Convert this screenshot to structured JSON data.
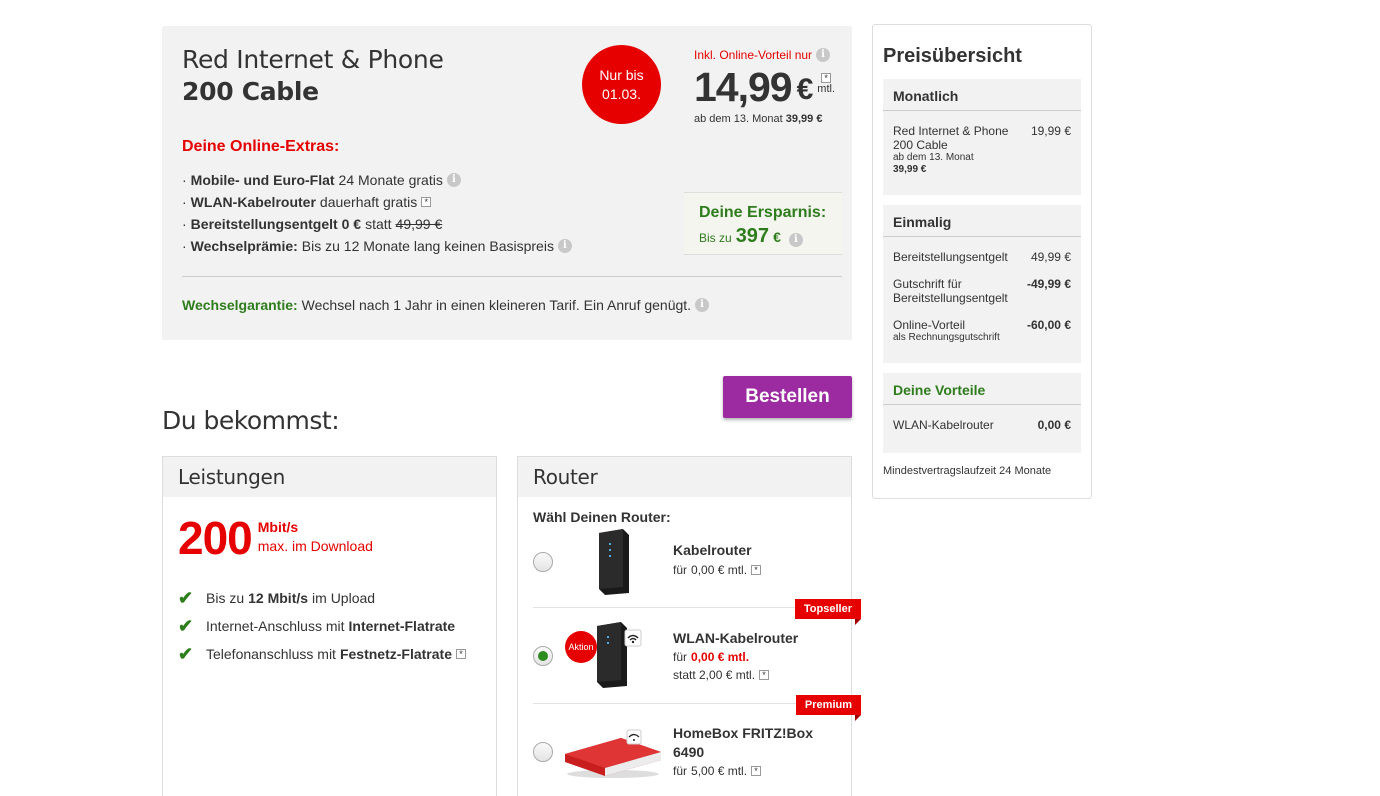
{
  "offer": {
    "title": "Red Internet & Phone",
    "subtitle": "200 Cable",
    "deadline_line1": "Nur bis",
    "deadline_line2": "01.03.",
    "online_advantage": "Inkl. Online-Vorteil nur",
    "price": "14,99",
    "currency": "€",
    "price_star": "*",
    "price_period": "mtl.",
    "price_later_prefix": "ab dem 13. Monat",
    "price_later_value": "39,99 €",
    "extras_title": "Deine Online-Extras:",
    "extras": [
      {
        "bullet": "·",
        "bold": "Mobile- und Euro-Flat",
        "text": "24 Monate gratis"
      },
      {
        "bullet": "·",
        "bold": "WLAN-Kabelrouter",
        "text": "dauerhaft gratis"
      },
      {
        "bullet": "·",
        "bold": "Bereitstellungsentgelt 0 €",
        "text": "statt",
        "strike": "49,99 €"
      },
      {
        "bullet": "·",
        "bold": "Wechselprämie:",
        "text": "Bis zu 12 Monate lang keinen Basispreis"
      }
    ],
    "savings_title": "Deine Ersparnis:",
    "savings_label": "Bis zu",
    "savings_value": "397",
    "savings_currency": "€",
    "guarantee_label": "Wechselgarantie:",
    "guarantee_text": "Wechsel nach 1 Jahr in einen kleineren Tarif. Ein Anruf genügt."
  },
  "order_button": "Bestellen",
  "section_heading": "Du bekommst:",
  "leistungen": {
    "title": "Leistungen",
    "speed_value": "200",
    "speed_unit": "Mbit/s",
    "speed_desc": "max. im Download",
    "features": [
      {
        "pre": "Bis zu",
        "bold": "12 Mbit/s",
        "post": "im Upload"
      },
      {
        "pre": "Internet-Anschluss mit",
        "bold": "Internet-Flatrate",
        "post": ""
      },
      {
        "pre": "Telefonanschluss mit",
        "bold": "Festnetz-Flatrate",
        "post": ""
      }
    ]
  },
  "router": {
    "title": "Router",
    "prompt": "Wähl Deinen Router:",
    "options": [
      {
        "name": "Kabelrouter",
        "price_prefix": "für",
        "price": "0,00 € mtl.",
        "selected": false
      },
      {
        "name": "WLAN-Kabelrouter",
        "price_prefix": "für",
        "price": "0,00 € mtl.",
        "old_price": "statt 2,00 € mtl.",
        "badge": "Aktion",
        "ribbon": "Topseller",
        "selected": true
      },
      {
        "name_line1": "HomeBox FRITZ!Box",
        "name_line2": "6490",
        "price_prefix": "für",
        "price": "5,00 € mtl.",
        "ribbon": "Premium",
        "selected": false
      }
    ]
  },
  "overview": {
    "title": "Preisübersicht",
    "monthly": {
      "head": "Monatlich",
      "item_line1": "Red Internet & Phone",
      "item_line2": "200 Cable",
      "item_sub": "ab dem 13. Monat",
      "item_sub_value": "39,99 €",
      "item_value": "19,99 €"
    },
    "onetime": {
      "head": "Einmalig",
      "rows": [
        {
          "label": "Bereitstellungsentgelt",
          "value": "49,99 €"
        },
        {
          "label_line1": "Gutschrift für",
          "label_line2": "Bereitstellungsentgelt",
          "value": "-49,99 €"
        },
        {
          "label": "Online-Vorteil",
          "sub": "als Rechnungsgutschrift",
          "value": "-60,00 €"
        }
      ]
    },
    "benefits": {
      "head": "Deine Vorteile",
      "label": "WLAN-Kabelrouter",
      "value": "0,00 €"
    },
    "min_term": "Mindestvertragslaufzeit 24 Monate"
  },
  "colors": {
    "vodafone_red": "#e60000",
    "accent_purple": "#9c2aa0",
    "success_green": "#2e7d1c"
  }
}
